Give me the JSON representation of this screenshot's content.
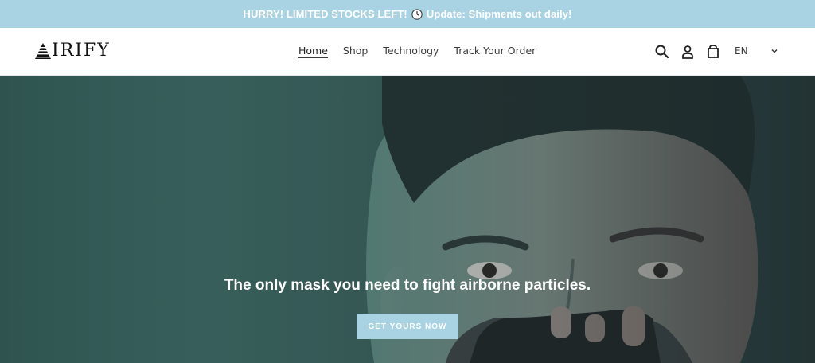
{
  "announcement": {
    "text_before": "HURRY! LIMITED STOCKS LEFT!",
    "icon": "clock-icon",
    "text_after": "Update: Shipments out daily!"
  },
  "header": {
    "logo_text": "IRIFY",
    "nav": [
      {
        "label": "Home",
        "active": true
      },
      {
        "label": "Shop",
        "active": false
      },
      {
        "label": "Technology",
        "active": false
      },
      {
        "label": "Track Your Order",
        "active": false
      }
    ],
    "icons": [
      "search-icon",
      "account-icon",
      "cart-icon"
    ],
    "language": "EN"
  },
  "hero": {
    "caption": "The only mask you need to fight airborne particles.",
    "button_label": "GET YOURS NOW"
  },
  "colors": {
    "accent": "#a9d2e3",
    "text": "#3a3a3a",
    "hero_bg": "#2f5450"
  }
}
